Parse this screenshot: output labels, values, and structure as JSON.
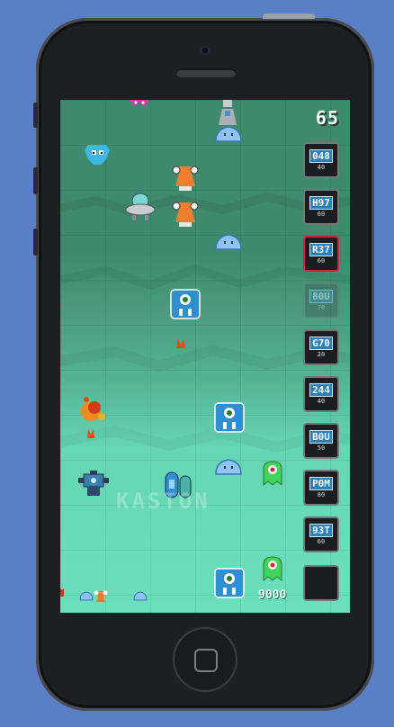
{
  "game": {
    "score": "65",
    "money": "9000",
    "watermark": "KASTON"
  },
  "tower_slots": [
    {
      "code": "048",
      "cost": "40"
    },
    {
      "code": "H97",
      "cost": "60"
    },
    {
      "code": "R37",
      "cost": "60",
      "selected": true
    },
    {
      "code": "80U",
      "cost": "70",
      "disabled": true
    },
    {
      "code": "G70",
      "cost": "20"
    },
    {
      "code": "244",
      "cost": "40"
    },
    {
      "code": "B0U",
      "cost": "50"
    },
    {
      "code": "P0M",
      "cost": "80"
    },
    {
      "code": "93T",
      "cost": "60"
    },
    {
      "code": "",
      "cost": ""
    }
  ],
  "colors": {
    "bg_outer": "#5a7fc4",
    "field_top": "#3f8a6e",
    "field_bottom": "#6be0bd",
    "slot_selected": "#d4243a"
  }
}
